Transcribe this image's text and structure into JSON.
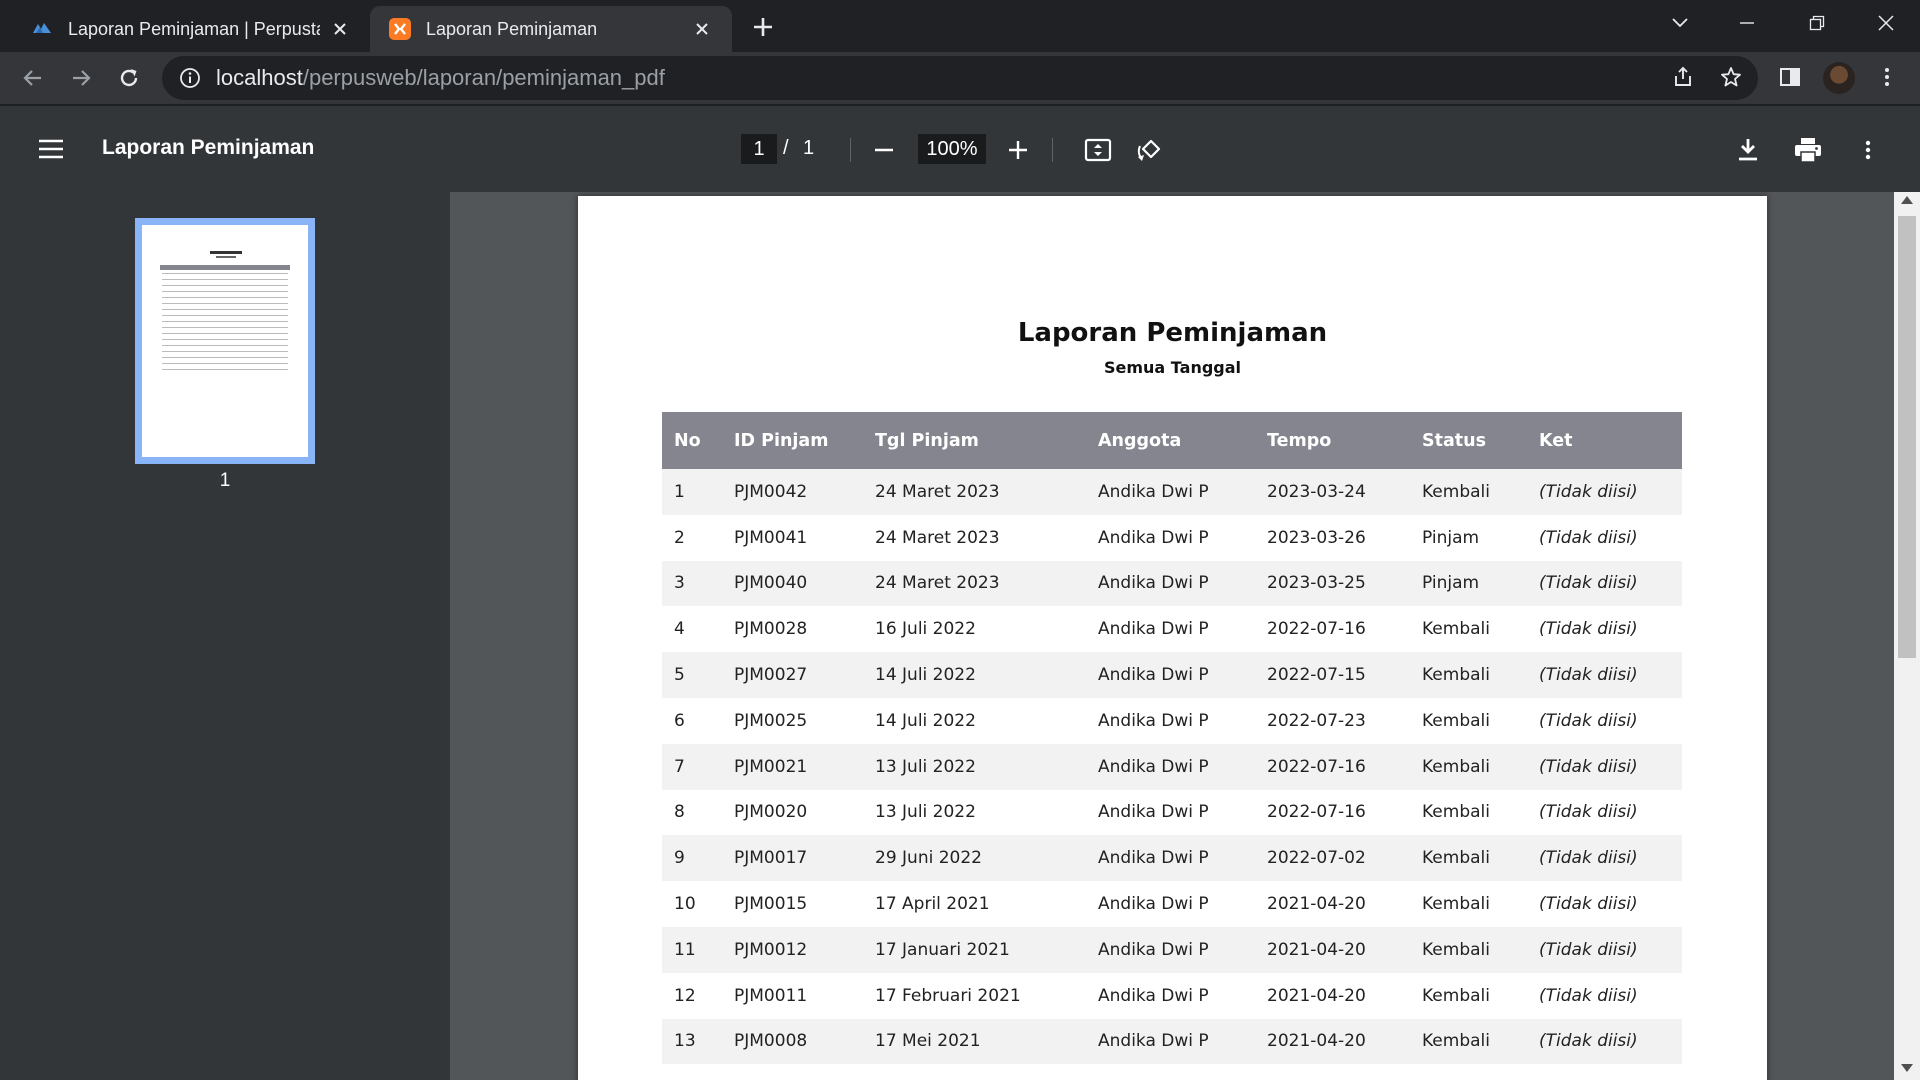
{
  "browser": {
    "tabs": [
      {
        "title": "Laporan Peminjaman | Perpustakaan",
        "active": false
      },
      {
        "title": "Laporan Peminjaman",
        "active": true
      }
    ],
    "url_host": "localhost",
    "url_path": "/perpusweb/laporan/peminjaman_pdf"
  },
  "pdf_viewer": {
    "title": "Laporan Peminjaman",
    "current_page": "1",
    "page_separator": "/",
    "total_pages": "1",
    "zoom": "100%",
    "thumbnail_label": "1"
  },
  "document": {
    "title": "Laporan Peminjaman",
    "subtitle": "Semua Tanggal",
    "columns": [
      "No",
      "ID Pinjam",
      "Tgl Pinjam",
      "Anggota",
      "Tempo",
      "Status",
      "Ket"
    ],
    "rows": [
      [
        "1",
        "PJM0042",
        "24 Maret 2023",
        "Andika Dwi P",
        "2023-03-24",
        "Kembali",
        "(Tidak diisi)"
      ],
      [
        "2",
        "PJM0041",
        "24 Maret 2023",
        "Andika Dwi P",
        "2023-03-26",
        "Pinjam",
        "(Tidak diisi)"
      ],
      [
        "3",
        "PJM0040",
        "24 Maret 2023",
        "Andika Dwi P",
        "2023-03-25",
        "Pinjam",
        "(Tidak diisi)"
      ],
      [
        "4",
        "PJM0028",
        "16 Juli 2022",
        "Andika Dwi P",
        "2022-07-16",
        "Kembali",
        "(Tidak diisi)"
      ],
      [
        "5",
        "PJM0027",
        "14 Juli 2022",
        "Andika Dwi P",
        "2022-07-15",
        "Kembali",
        "(Tidak diisi)"
      ],
      [
        "6",
        "PJM0025",
        "14 Juli 2022",
        "Andika Dwi P",
        "2022-07-23",
        "Kembali",
        "(Tidak diisi)"
      ],
      [
        "7",
        "PJM0021",
        "13 Juli 2022",
        "Andika Dwi P",
        "2022-07-16",
        "Kembali",
        "(Tidak diisi)"
      ],
      [
        "8",
        "PJM0020",
        "13 Juli 2022",
        "Andika Dwi P",
        "2022-07-16",
        "Kembali",
        "(Tidak diisi)"
      ],
      [
        "9",
        "PJM0017",
        "29 Juni 2022",
        "Andika Dwi P",
        "2022-07-02",
        "Kembali",
        "(Tidak diisi)"
      ],
      [
        "10",
        "PJM0015",
        "17 April 2021",
        "Andika Dwi P",
        "2021-04-20",
        "Kembali",
        "(Tidak diisi)"
      ],
      [
        "11",
        "PJM0012",
        "17 Januari 2021",
        "Andika Dwi P",
        "2021-04-20",
        "Kembali",
        "(Tidak diisi)"
      ],
      [
        "12",
        "PJM0011",
        "17 Februari 2021",
        "Andika Dwi P",
        "2021-04-20",
        "Kembali",
        "(Tidak diisi)"
      ],
      [
        "13",
        "PJM0008",
        "17 Mei 2021",
        "Andika Dwi P",
        "2021-04-20",
        "Kembali",
        "(Tidak diisi)"
      ]
    ]
  },
  "colors": {
    "header_row": "#858590",
    "striped_row": "#f2f2f2",
    "viewer_bg": "#525659",
    "toolbar_bg": "#323639"
  },
  "icons": [
    "menu-icon",
    "minus-icon",
    "plus-icon",
    "fit-page-icon",
    "rotate-icon",
    "download-icon",
    "print-icon",
    "more-vert-icon",
    "back-icon",
    "forward-icon",
    "reload-icon",
    "info-icon",
    "share-icon",
    "star-icon",
    "sidepanel-icon",
    "close-icon",
    "chevron-down-icon"
  ]
}
